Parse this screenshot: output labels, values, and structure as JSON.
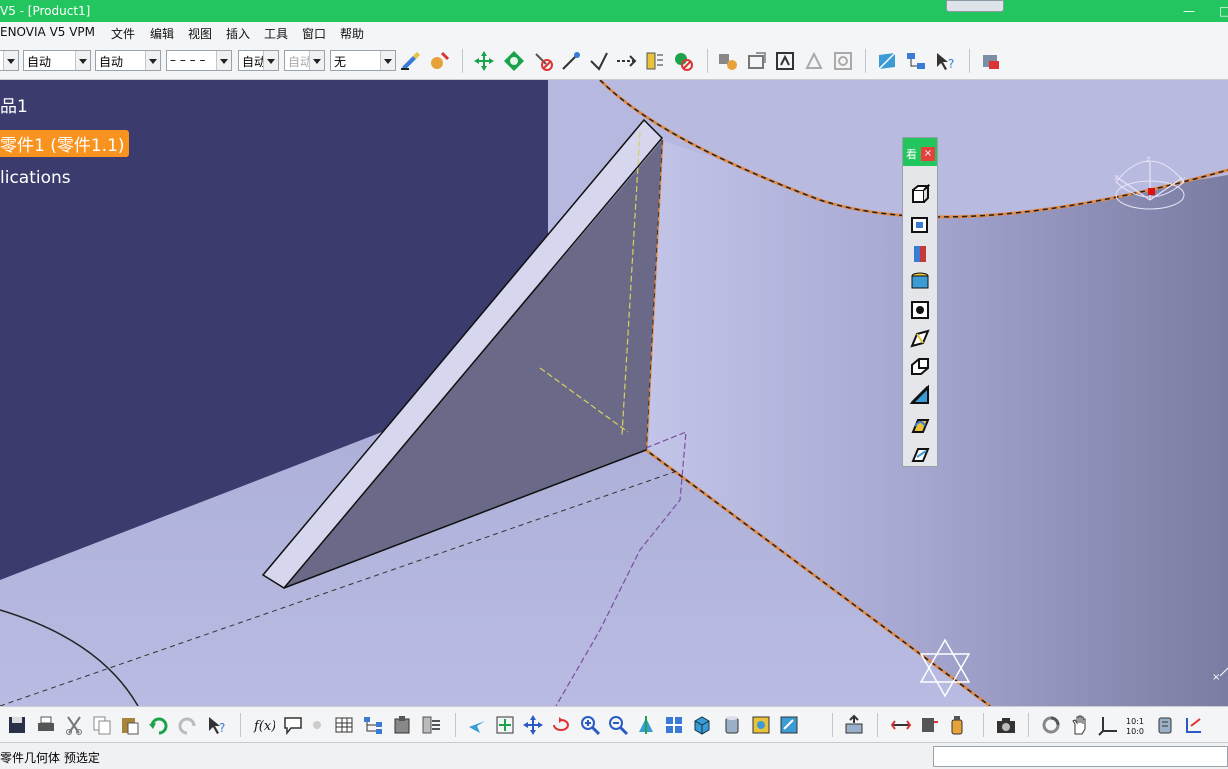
{
  "window": {
    "title": "V5 - [Product1]"
  },
  "menu": {
    "items": [
      "ENOVIA V5 VPM",
      "文件",
      "编辑",
      "视图",
      "插入",
      "工具",
      "窗口",
      "帮助"
    ]
  },
  "toolbar": {
    "combos": [
      {
        "value": "",
        "enabled": true
      },
      {
        "value": "自动",
        "enabled": true
      },
      {
        "value": "自动",
        "enabled": true
      },
      {
        "value": "– – – –",
        "enabled": true
      },
      {
        "value": "自动",
        "enabled": true
      },
      {
        "value": "自动",
        "enabled": false
      },
      {
        "value": "无",
        "enabled": true
      }
    ]
  },
  "tree": {
    "root": "品1",
    "selected_part": "零件1 (零件1.1)",
    "applications": "lications"
  },
  "palette": {
    "header_label": "看"
  },
  "statusbar": {
    "message": "零件几何体 预选定",
    "command_input": ""
  },
  "colors": {
    "accent_green": "#22c55e",
    "selection_orange": "#f7931e",
    "background_dark": "#3b3b6e",
    "part_light": "#b6b8e0"
  }
}
